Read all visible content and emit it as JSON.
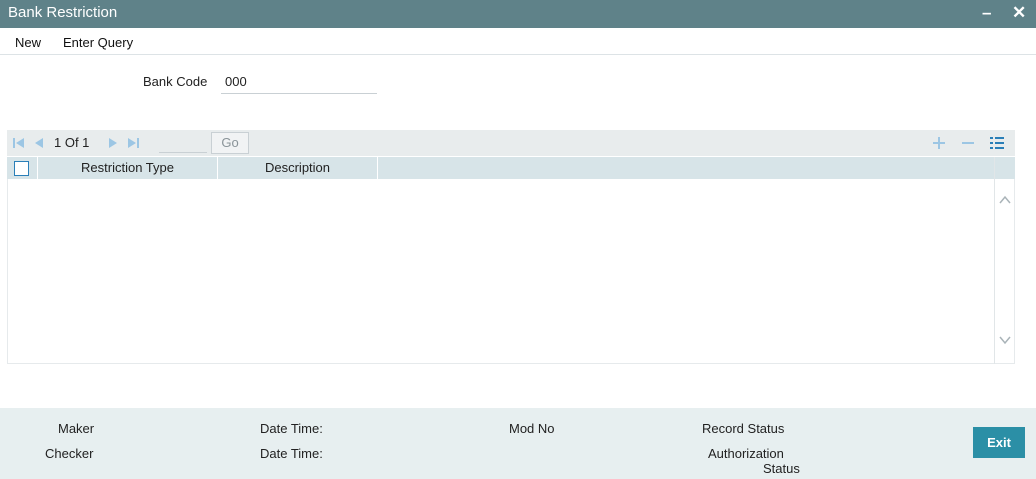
{
  "window": {
    "title": "Bank Restriction",
    "minimize_label": "–",
    "close_label": "✕"
  },
  "menu": {
    "items": [
      "New",
      "Enter Query"
    ]
  },
  "form": {
    "bank_code_label": "Bank Code",
    "bank_code_value": "000"
  },
  "grid": {
    "pagination": {
      "current": "1",
      "separator": "Of",
      "total": "1",
      "text": "1 Of 1"
    },
    "go_label": "Go",
    "columns": [
      "Restriction Type",
      "Description"
    ],
    "rows": []
  },
  "footer": {
    "maker_label": "Maker",
    "checker_label": "Checker",
    "date_time_label_1": "Date Time:",
    "date_time_label_2": "Date Time:",
    "mod_no_label": "Mod No",
    "record_status_label": "Record Status",
    "authorization_status_label_line1": "Authorization",
    "authorization_status_label_line2": "Status",
    "exit_label": "Exit"
  },
  "colors": {
    "titlebar": "#5f8289",
    "grid_header": "#d7e4e8",
    "footer": "#e7eff0",
    "exit_button": "#2b8fa6",
    "nav_icons": "#9cc6e4",
    "toolbar_icons": "#2a7fb8"
  },
  "icons": {
    "first_page": "first-page-icon",
    "prev_page": "prev-page-icon",
    "next_page": "next-page-icon",
    "last_page": "last-page-icon",
    "add_row": "plus-icon",
    "delete_row": "minus-icon",
    "single_view": "list-view-icon",
    "scroll_up": "chevron-up-icon",
    "scroll_down": "chevron-down-icon"
  }
}
